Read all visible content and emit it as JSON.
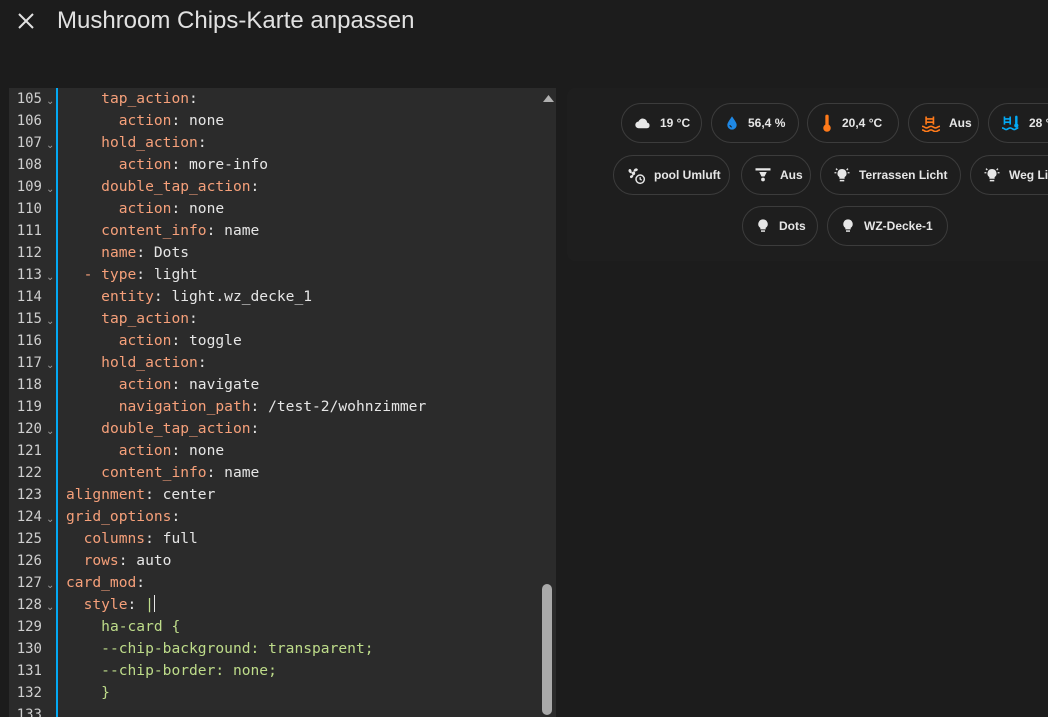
{
  "header": {
    "title": "Mushroom Chips-Karte anpassen",
    "close_icon": "close-icon"
  },
  "editor": {
    "lines": [
      {
        "n": "105",
        "fold": true,
        "parts": [
          [
            "i",
            "    "
          ],
          [
            "k",
            "tap_action"
          ],
          [
            "p",
            ":"
          ]
        ]
      },
      {
        "n": "106",
        "fold": false,
        "parts": [
          [
            "i",
            "      "
          ],
          [
            "k",
            "action"
          ],
          [
            "p",
            ": none"
          ]
        ]
      },
      {
        "n": "107",
        "fold": true,
        "parts": [
          [
            "i",
            "    "
          ],
          [
            "k",
            "hold_action"
          ],
          [
            "p",
            ":"
          ]
        ]
      },
      {
        "n": "108",
        "fold": false,
        "parts": [
          [
            "i",
            "      "
          ],
          [
            "k",
            "action"
          ],
          [
            "p",
            ": more-info"
          ]
        ]
      },
      {
        "n": "109",
        "fold": true,
        "parts": [
          [
            "i",
            "    "
          ],
          [
            "k",
            "double_tap_action"
          ],
          [
            "p",
            ":"
          ]
        ]
      },
      {
        "n": "110",
        "fold": false,
        "parts": [
          [
            "i",
            "      "
          ],
          [
            "k",
            "action"
          ],
          [
            "p",
            ": none"
          ]
        ]
      },
      {
        "n": "111",
        "fold": false,
        "parts": [
          [
            "i",
            "    "
          ],
          [
            "k",
            "content_info"
          ],
          [
            "p",
            ": name"
          ]
        ]
      },
      {
        "n": "112",
        "fold": false,
        "parts": [
          [
            "i",
            "    "
          ],
          [
            "k",
            "name"
          ],
          [
            "p",
            ": Dots"
          ]
        ]
      },
      {
        "n": "113",
        "fold": true,
        "parts": [
          [
            "i",
            "  "
          ],
          [
            "k",
            "- type"
          ],
          [
            "p",
            ": light"
          ]
        ]
      },
      {
        "n": "114",
        "fold": false,
        "parts": [
          [
            "i",
            "    "
          ],
          [
            "k",
            "entity"
          ],
          [
            "p",
            ": light.wz_decke_1"
          ]
        ]
      },
      {
        "n": "115",
        "fold": true,
        "parts": [
          [
            "i",
            "    "
          ],
          [
            "k",
            "tap_action"
          ],
          [
            "p",
            ":"
          ]
        ]
      },
      {
        "n": "116",
        "fold": false,
        "parts": [
          [
            "i",
            "      "
          ],
          [
            "k",
            "action"
          ],
          [
            "p",
            ": toggle"
          ]
        ]
      },
      {
        "n": "117",
        "fold": true,
        "parts": [
          [
            "i",
            "    "
          ],
          [
            "k",
            "hold_action"
          ],
          [
            "p",
            ":"
          ]
        ]
      },
      {
        "n": "118",
        "fold": false,
        "parts": [
          [
            "i",
            "      "
          ],
          [
            "k",
            "action"
          ],
          [
            "p",
            ": navigate"
          ]
        ]
      },
      {
        "n": "119",
        "fold": false,
        "parts": [
          [
            "i",
            "      "
          ],
          [
            "k",
            "navigation_path"
          ],
          [
            "p",
            ": /test-2/wohnzimmer"
          ]
        ]
      },
      {
        "n": "120",
        "fold": true,
        "parts": [
          [
            "i",
            "    "
          ],
          [
            "k",
            "double_tap_action"
          ],
          [
            "p",
            ":"
          ]
        ]
      },
      {
        "n": "121",
        "fold": false,
        "parts": [
          [
            "i",
            "      "
          ],
          [
            "k",
            "action"
          ],
          [
            "p",
            ": none"
          ]
        ]
      },
      {
        "n": "122",
        "fold": false,
        "parts": [
          [
            "i",
            "    "
          ],
          [
            "k",
            "content_info"
          ],
          [
            "p",
            ": name"
          ]
        ]
      },
      {
        "n": "123",
        "fold": false,
        "parts": [
          [
            "k",
            "alignment"
          ],
          [
            "p",
            ": center"
          ]
        ]
      },
      {
        "n": "124",
        "fold": true,
        "parts": [
          [
            "k",
            "grid_options"
          ],
          [
            "p",
            ":"
          ]
        ]
      },
      {
        "n": "125",
        "fold": false,
        "parts": [
          [
            "i",
            "  "
          ],
          [
            "k",
            "columns"
          ],
          [
            "p",
            ": full"
          ]
        ]
      },
      {
        "n": "126",
        "fold": false,
        "parts": [
          [
            "i",
            "  "
          ],
          [
            "k",
            "rows"
          ],
          [
            "p",
            ": auto"
          ]
        ]
      },
      {
        "n": "127",
        "fold": true,
        "parts": [
          [
            "k",
            "card_mod"
          ],
          [
            "p",
            ":"
          ]
        ]
      },
      {
        "n": "128",
        "fold": true,
        "parts": [
          [
            "i",
            "  "
          ],
          [
            "k",
            "style"
          ],
          [
            "p",
            ": "
          ],
          [
            "s",
            "|"
          ],
          [
            "c",
            ""
          ]
        ]
      },
      {
        "n": "129",
        "fold": false,
        "parts": [
          [
            "i",
            "    "
          ],
          [
            "s",
            "ha-card {"
          ]
        ]
      },
      {
        "n": "130",
        "fold": false,
        "parts": [
          [
            "i",
            "    "
          ],
          [
            "s",
            "--chip-background: transparent;"
          ]
        ]
      },
      {
        "n": "131",
        "fold": false,
        "parts": [
          [
            "i",
            "    "
          ],
          [
            "s",
            "--chip-border: none;"
          ]
        ]
      },
      {
        "n": "132",
        "fold": false,
        "parts": [
          [
            "i",
            "    "
          ],
          [
            "s",
            "}"
          ]
        ]
      },
      {
        "n": "133",
        "fold": false,
        "parts": []
      }
    ],
    "scroll_up_icon": "triangle-up-icon"
  },
  "colors": {
    "editor_key": "#f6a07a",
    "editor_string": "#bedc8a",
    "active_line_bar": "#03a9f4",
    "icon_blue": "#1e88e5",
    "icon_orange": "#ff7a1a",
    "icon_cyan": "#03a9f4"
  },
  "chips": [
    {
      "label": "19 °C",
      "icon": "cloud-icon"
    },
    {
      "label": "56,4 %",
      "icon": "water-drop-icon"
    },
    {
      "label": "20,4 °C",
      "icon": "thermometer-icon"
    },
    {
      "label": "Aus",
      "icon": "pool-icon"
    },
    {
      "label": "28 °",
      "icon": "pool-thermometer-icon"
    },
    {
      "label": "pool Umluft",
      "icon": "fan-clock-icon"
    },
    {
      "label": "Aus",
      "icon": "ceiling-spotlight-icon"
    },
    {
      "label": "Terrassen Licht",
      "icon": "outdoor-light-icon"
    },
    {
      "label": "Weg Li",
      "icon": "outdoor-light-icon"
    },
    {
      "label": "Dots",
      "icon": "lightbulb-icon"
    },
    {
      "label": "WZ-Decke-1",
      "icon": "lightbulb-icon"
    }
  ]
}
